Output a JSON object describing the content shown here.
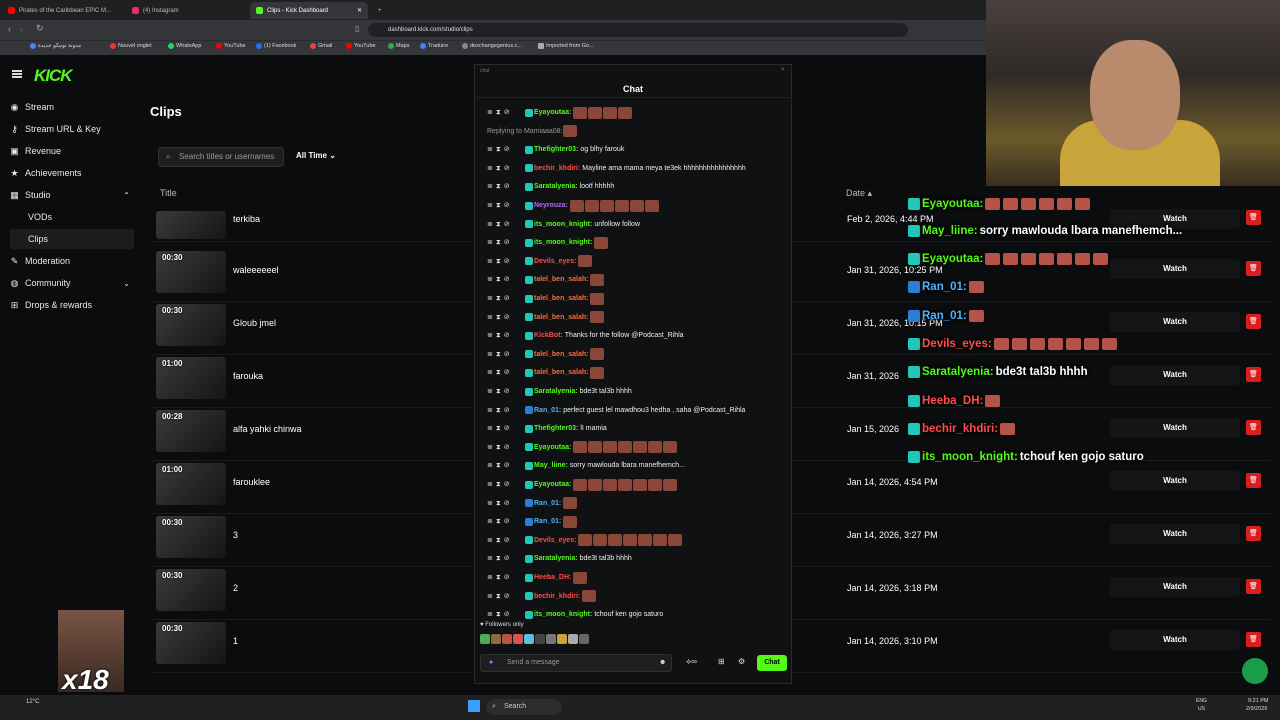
{
  "browser": {
    "tabs": [
      {
        "label": "Pirates of the Caribbean EPIC M...",
        "color": "#ff0000"
      },
      {
        "label": "(4) Instagram",
        "color": "#e1306c"
      },
      {
        "label": "Clips - Kick Dashboard",
        "color": "#53fc18"
      }
    ],
    "url": "dashboard.kick.com/studio/clips",
    "bookmarks": [
      "مدونة تونيكو جديدة",
      "Nouvel onglet",
      "WhatsApp",
      "YouTube",
      "(1) Facebook",
      "Gmail",
      "YouTube",
      "Maps",
      "Traduire",
      "dexchangegenius.c...",
      "Imported from Go..."
    ]
  },
  "app": {
    "logo": "KICK",
    "nav": [
      {
        "label": "Stream",
        "icon": "radio-icon"
      },
      {
        "label": "Stream URL & Key",
        "icon": "key-icon"
      },
      {
        "label": "Revenue",
        "icon": "revenue-icon"
      },
      {
        "label": "Achievements",
        "icon": "trophy-icon"
      },
      {
        "label": "Studio",
        "icon": "studio-icon"
      },
      {
        "label": "VODs",
        "icon": ""
      },
      {
        "label": "Clips",
        "icon": ""
      },
      {
        "label": "Moderation",
        "icon": "wrench-icon"
      },
      {
        "label": "Community",
        "icon": "globe-icon"
      },
      {
        "label": "Drops & rewards",
        "icon": "gift-icon"
      }
    ],
    "page_title": "Clips",
    "search_placeholder": "Search titles or usernames",
    "filter": "All Time",
    "col_title": "Title",
    "col_date": "Date",
    "accent": "#53fc18",
    "clips": [
      {
        "duration": "",
        "title": "terkiba",
        "date": "Feb 2, 2026, 4:44 PM",
        "watch": "Watch"
      },
      {
        "duration": "00:30",
        "title": "waleeeeeel",
        "date": "Jan 31, 2026, 10:25 PM",
        "watch": "Watch"
      },
      {
        "duration": "00:30",
        "title": "Gloub jmel",
        "date": "Jan 31, 2026, 10:15 PM",
        "watch": "Watch"
      },
      {
        "duration": "01:00",
        "title": "farouka",
        "date": "Jan 31, 2026",
        "watch": "Watch"
      },
      {
        "duration": "00:28",
        "title": "alfa yahki chinwa",
        "date": "Jan 15, 2026",
        "watch": "Watch"
      },
      {
        "duration": "01:00",
        "title": "farouklee",
        "date": "Jan 14, 2026, 4:54 PM",
        "watch": "Watch"
      },
      {
        "duration": "00:30",
        "title": "3",
        "date": "Jan 14, 2026, 3:27 PM",
        "watch": "Watch"
      },
      {
        "duration": "00:30",
        "title": "2",
        "date": "Jan 14, 2026, 3:18 PM",
        "watch": "Watch"
      },
      {
        "duration": "00:30",
        "title": "1",
        "date": "Jan 14, 2026, 3:10 PM",
        "watch": "Watch"
      }
    ]
  },
  "chat": {
    "window_label": "chat",
    "title": "Chat",
    "messages": [
      {
        "user": "Eyayoutaa",
        "color": "#53fc18",
        "text": "",
        "emotes": 4
      },
      {
        "user": "",
        "color": "#999",
        "text": "Replying to Mamiaaa08:",
        "emotes": 1
      },
      {
        "user": "Thefighter03",
        "color": "#53fc18",
        "text": "og blhy farouk",
        "emotes": 0
      },
      {
        "user": "bechir_khdiri",
        "color": "#ff4d4d",
        "text": "Mayline ama mama meya te3ek hhhhhhhhhhhhhhhh",
        "emotes": 0
      },
      {
        "user": "Saratalyenia",
        "color": "#53fc18",
        "text": "lootf hhhhh",
        "emotes": 0
      },
      {
        "user": "Neyrouza",
        "color": "#b06cff",
        "text": "",
        "emotes": 6
      },
      {
        "user": "its_moon_knight",
        "color": "#53fc18",
        "text": "unfollow follow",
        "emotes": 0
      },
      {
        "user": "its_moon_knight",
        "color": "#53fc18",
        "text": "",
        "emotes": 1
      },
      {
        "user": "Devils_eyes",
        "color": "#ff4d4d",
        "text": "",
        "emotes": 1
      },
      {
        "user": "talel_ben_salah",
        "color": "#ff6a3d",
        "text": "",
        "emotes": 1
      },
      {
        "user": "talel_ben_salah",
        "color": "#ff6a3d",
        "text": "",
        "emotes": 1
      },
      {
        "user": "talel_ben_salah",
        "color": "#ff6a3d",
        "text": "",
        "emotes": 1
      },
      {
        "user": "KickBot",
        "color": "#ff4d4d",
        "text": "Thanks for the follow @Podcast_Rihla",
        "emotes": 0
      },
      {
        "user": "talel_ben_salah",
        "color": "#ff6a3d",
        "text": "",
        "emotes": 1
      },
      {
        "user": "talel_ben_salah",
        "color": "#ff6a3d",
        "text": "",
        "emotes": 1
      },
      {
        "user": "Saratalyenia",
        "color": "#53fc18",
        "text": "bde3t tal3b hhhh",
        "emotes": 0
      },
      {
        "user": "Ran_01",
        "color": "#4fb3ff",
        "text": "perfect guest lel mawdhou3 hedha , saha @Podcast_Rihla",
        "emotes": 0
      },
      {
        "user": "Thefighter03",
        "color": "#53fc18",
        "text": "lI mamia",
        "emotes": 0
      },
      {
        "user": "Eyayoutaa",
        "color": "#53fc18",
        "text": "",
        "emotes": 7
      },
      {
        "user": "May_liine",
        "color": "#53fc18",
        "text": "sorry mawlouda lbara manefhemch...",
        "emotes": 0
      },
      {
        "user": "Eyayoutaa",
        "color": "#53fc18",
        "text": "",
        "emotes": 7
      },
      {
        "user": "Ran_01",
        "color": "#4fb3ff",
        "text": "",
        "emotes": 1
      },
      {
        "user": "Ran_01",
        "color": "#4fb3ff",
        "text": "",
        "emotes": 1
      },
      {
        "user": "Devils_eyes",
        "color": "#ff4d4d",
        "text": "",
        "emotes": 7
      },
      {
        "user": "Saratalyenia",
        "color": "#53fc18",
        "text": "bde3t tal3b hhhh",
        "emotes": 0
      },
      {
        "user": "Heeba_DH",
        "color": "#ff4d4d",
        "text": "",
        "emotes": 1
      },
      {
        "user": "bechir_khdiri",
        "color": "#ff4d4d",
        "text": "",
        "emotes": 1
      },
      {
        "user": "its_moon_knight",
        "color": "#53fc18",
        "text": "tchouf ken gojo saturo",
        "emotes": 0
      }
    ],
    "followers_only": "Followers only",
    "message_placeholder": "Send a message",
    "send_label": "Chat"
  },
  "overlay": [
    {
      "user": "Eyayoutaa",
      "text": "",
      "color": "#53fc18",
      "emotes": 6
    },
    {
      "user": "May_liine",
      "text": "sorry mawlouda lbara manefhemch...",
      "color": "#53fc18",
      "emotes": 0
    },
    {
      "user": "Eyayoutaa",
      "text": "",
      "color": "#53fc18",
      "emotes": 7
    },
    {
      "user": "Ran_01",
      "text": "",
      "color": "#4fb3ff",
      "emotes": 1
    },
    {
      "user": "Ran_01",
      "text": "",
      "color": "#4fb3ff",
      "emotes": 1
    },
    {
      "user": "Devils_eyes",
      "text": "",
      "color": "#ff4d4d",
      "emotes": 7
    },
    {
      "user": "Saratalyenia",
      "text": "bde3t tal3b hhhh",
      "color": "#53fc18",
      "emotes": 0
    },
    {
      "user": "Heeba_DH",
      "text": "",
      "color": "#ff4d4d",
      "emotes": 1
    },
    {
      "user": "bechir_khdiri",
      "text": "",
      "color": "#ff4d4d",
      "emotes": 1
    },
    {
      "user": "its_moon_knight",
      "text": "tchouf ken gojo saturo",
      "color": "#53fc18",
      "emotes": 0
    }
  ],
  "meme": {
    "label": "x18"
  },
  "taskbar": {
    "weather": "12°C",
    "search": "Search",
    "lang": "ENG",
    "region": "US",
    "time": "9:21 PM",
    "date": "2/9/2026"
  }
}
